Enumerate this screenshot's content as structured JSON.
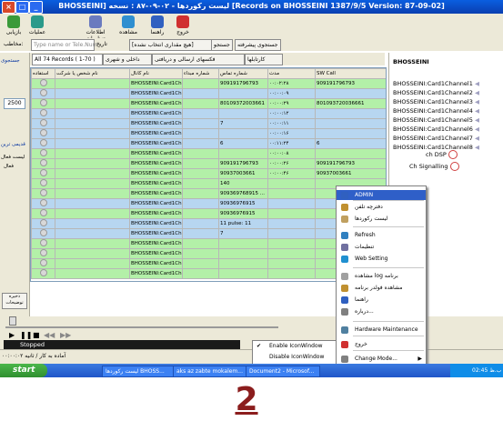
{
  "window": {
    "title": "BHOSSEINI] لیست رکوردها - ۰۲-۰۹-۸۷ : نسخه [Records on BHOSSEINI 1387/9/5 Version: 87-09-02]",
    "min": "_",
    "max": "□",
    "close": "×"
  },
  "toolbar": [
    {
      "label": "خروج"
    },
    {
      "label": "راهنما"
    },
    {
      "label": "مشاهده"
    },
    {
      "label": "اطلاعات تنظیمات"
    },
    {
      "label": "عملیات"
    },
    {
      "label": "بازیابی"
    }
  ],
  "filter": {
    "search_button": "جستجوی پیشرفته",
    "search2": "جستجو",
    "amount_select": "[هیچ مقداری انتخاب نشده]",
    "date_label": "تاریخ",
    "input_placeholder": "Type name or Tele.Num",
    "contact_label": "مخاطب:"
  },
  "tabs": [
    {
      "label": "All 74 Records ( 1-70 )"
    },
    {
      "label": "داخلی و شهری"
    },
    {
      "label": "فکسهای ارسالی و دریافتی"
    },
    {
      "label": "کارتابلها"
    }
  ],
  "left_panel": {
    "top_label": "جستجوی",
    "value": "2500",
    "label_a": "قدیمی ترین",
    "label_b": "لیست فعال",
    "label_c": "فعال",
    "bottom_btn": "ذخیره توضیحات"
  },
  "grid": {
    "headers": [
      "استفاده",
      "نام شخص یا شرکت",
      "نام کانال",
      "شماره مبداء",
      "شماره تماس",
      "مدت",
      "SW Call"
    ],
    "rows": [
      {
        "channel": "BHOSSEINI:Card1Ch...",
        "src": "",
        "num": "909191796793",
        "dur": "۰۰:۰۲:۲۸",
        "sw": "909191796793",
        "c": "g"
      },
      {
        "channel": "BHOSSEINI:Card1Ch...",
        "src": "",
        "num": "",
        "dur": "۰۰:۰۰:۰۹",
        "sw": "",
        "c": "b"
      },
      {
        "channel": "BHOSSEINI:Card1Ch...",
        "src": "",
        "num": "80109372003661",
        "dur": "۰۰:۰۰:۲۹",
        "sw": "801093720036661",
        "c": "g"
      },
      {
        "channel": "BHOSSEINI:Card1Ch...",
        "src": "",
        "num": "",
        "dur": "۰۰:۰۰:۱۲",
        "sw": "",
        "c": "b"
      },
      {
        "channel": "BHOSSEINI:Card1Ch...",
        "src": "",
        "num": "7",
        "dur": "۰۰:۰۰:۱۱",
        "sw": "",
        "c": "b"
      },
      {
        "channel": "BHOSSEINI:Card1Ch...",
        "src": "",
        "num": "",
        "dur": "۰۰:۰۰:۱۶",
        "sw": "",
        "c": "b"
      },
      {
        "channel": "BHOSSEINI:Card1Ch...",
        "src": "",
        "num": "6",
        "dur": "۰۰:۱۱:۲۴",
        "sw": "6",
        "c": "b"
      },
      {
        "channel": "BHOSSEINI:Card1Ch...",
        "src": "",
        "num": "",
        "dur": "۰۰:۰۰:۰۸",
        "sw": "",
        "c": "g"
      },
      {
        "channel": "BHOSSEINI:Card1Ch...",
        "src": "",
        "num": "909191796793",
        "dur": "۰۰:۰۰:۲۶",
        "sw": "909191796793",
        "c": "g"
      },
      {
        "channel": "BHOSSEINI:Card1Ch...",
        "src": "",
        "num": "90937003661",
        "dur": "۰۰:۰۰:۴۶",
        "sw": "90937003661",
        "c": "g"
      },
      {
        "channel": "BHOSSEINI:Card1Ch...",
        "src": "",
        "num": "140",
        "dur": "",
        "sw": "",
        "c": "g"
      },
      {
        "channel": "BHOSSEINI:Card1Ch...",
        "src": "",
        "num": "909369768915 ...",
        "dur": "",
        "sw": "",
        "c": "g"
      },
      {
        "channel": "BHOSSEINI:Card1Ch...",
        "src": "",
        "num": "90936976915",
        "dur": "",
        "sw": "",
        "c": "b"
      },
      {
        "channel": "BHOSSEINI:Card1Ch...",
        "src": "",
        "num": "90936976915",
        "dur": "",
        "sw": "",
        "c": "g"
      },
      {
        "channel": "BHOSSEINI:Card1Ch...",
        "src": "",
        "num": "11 pulse: 11",
        "dur": "",
        "sw": "",
        "c": "b"
      },
      {
        "channel": "BHOSSEINI:Card1Ch...",
        "src": "",
        "num": "7",
        "dur": "",
        "sw": "",
        "c": "b"
      },
      {
        "channel": "BHOSSEINI:Card1Ch...",
        "src": "",
        "num": "",
        "dur": "",
        "sw": "",
        "c": "g"
      },
      {
        "channel": "BHOSSEINI:Card1Ch...",
        "src": "",
        "num": "",
        "dur": "",
        "sw": "",
        "c": "g"
      },
      {
        "channel": "BHOSSEINI:Card1Ch...",
        "src": "",
        "num": "",
        "dur": "",
        "sw": "",
        "c": "g"
      },
      {
        "channel": "BHOSSEINI:Card1Ch...",
        "src": "",
        "num": "",
        "dur": "",
        "sw": "",
        "c": "g"
      }
    ]
  },
  "tree": {
    "root": "BHOSSEINI",
    "channels": [
      "BHOSSEINI:Card1Channel1",
      "BHOSSEINI:Card1Channel2",
      "BHOSSEINI:Card1Channel3",
      "BHOSSEINI:Card1Channel4",
      "BHOSSEINI:Card1Channel5",
      "BHOSSEINI:Card1Channel6",
      "BHOSSEINI:Card1Channel7",
      "BHOSSEINI:Card1Channel8"
    ],
    "dsp": "ch DSP",
    "signalling": "Ch Signalling"
  },
  "player": {
    "status": "Stopped",
    "status_line": "آماده به کار / ثانیه ۰۰:۰۰:۰۲"
  },
  "context_menu": {
    "items": [
      {
        "label": "ADMIN"
      },
      {
        "label": "دفترچه تلفن"
      },
      {
        "label": "لیست رکوردها"
      },
      {
        "label": "Refresh"
      },
      {
        "label": "تنظیمات"
      },
      {
        "label": "Web Setting"
      },
      {
        "label": "مشاهده log برنامه"
      },
      {
        "label": "مشاهده فولدر برنامه"
      },
      {
        "label": "راهنما"
      },
      {
        "label": "درباره..."
      },
      {
        "label": "Hardware Maintenance"
      },
      {
        "label": "خروج"
      },
      {
        "label": "Change Mode..."
      }
    ],
    "submenu": [
      "Enable IconWindow",
      "Disable IconWindow"
    ]
  },
  "taskbar": {
    "start": "start",
    "tasks": [
      "لیست رکوردها BHOSS...",
      "aks az zabte mokalem...",
      "Document2 - Microsof..."
    ],
    "clock": "02:45 ب.ظ"
  },
  "figure_number": "2"
}
